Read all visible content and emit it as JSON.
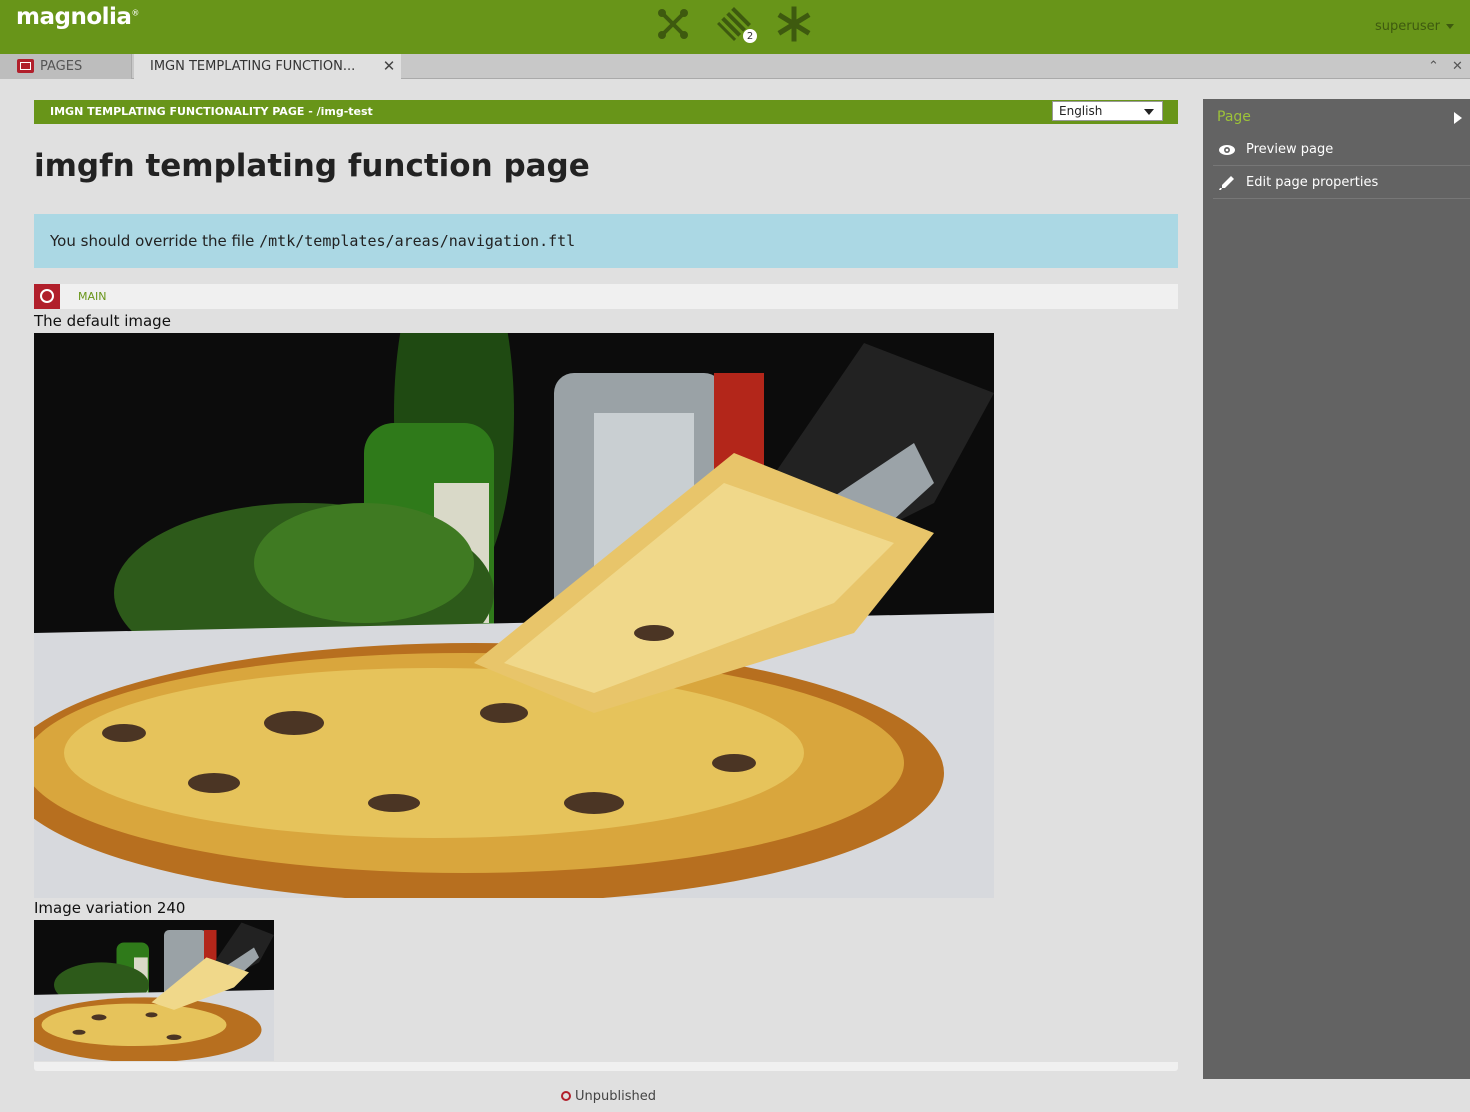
{
  "brand": {
    "logo": "magnolia",
    "primary": "#689519",
    "danger": "#b11f2b",
    "notice_bg": "#abd8e4"
  },
  "topbar": {
    "apps": [
      {
        "icon": "app-launcher-icon"
      },
      {
        "icon": "pulse-icon",
        "badge": "2"
      },
      {
        "icon": "favorites-icon"
      }
    ],
    "user": "superuser"
  },
  "tabs": {
    "pages_label": "PAGES",
    "active_label": "IMGN TEMPLATING FUNCTION...",
    "close_symbol": "✕",
    "window_controls": {
      "minimize": "⌃",
      "close": "✕"
    }
  },
  "main": {
    "header": "IMGN TEMPLATING FUNCTIONALITY PAGE - /img-test",
    "language": "English",
    "title": "imgfn templating function page",
    "notice_prefix": "You should override the file ",
    "notice_path": "/mtk/templates/areas/navigation.ftl",
    "area_label": "MAIN",
    "images": [
      {
        "caption": "The default image"
      },
      {
        "caption": "Image variation 240"
      }
    ],
    "status": "Unpublished"
  },
  "actionbar": {
    "section": "Page",
    "actions": [
      {
        "label": "Preview page",
        "icon": "eye-icon"
      },
      {
        "label": "Edit page properties",
        "icon": "pencil-icon"
      }
    ]
  }
}
